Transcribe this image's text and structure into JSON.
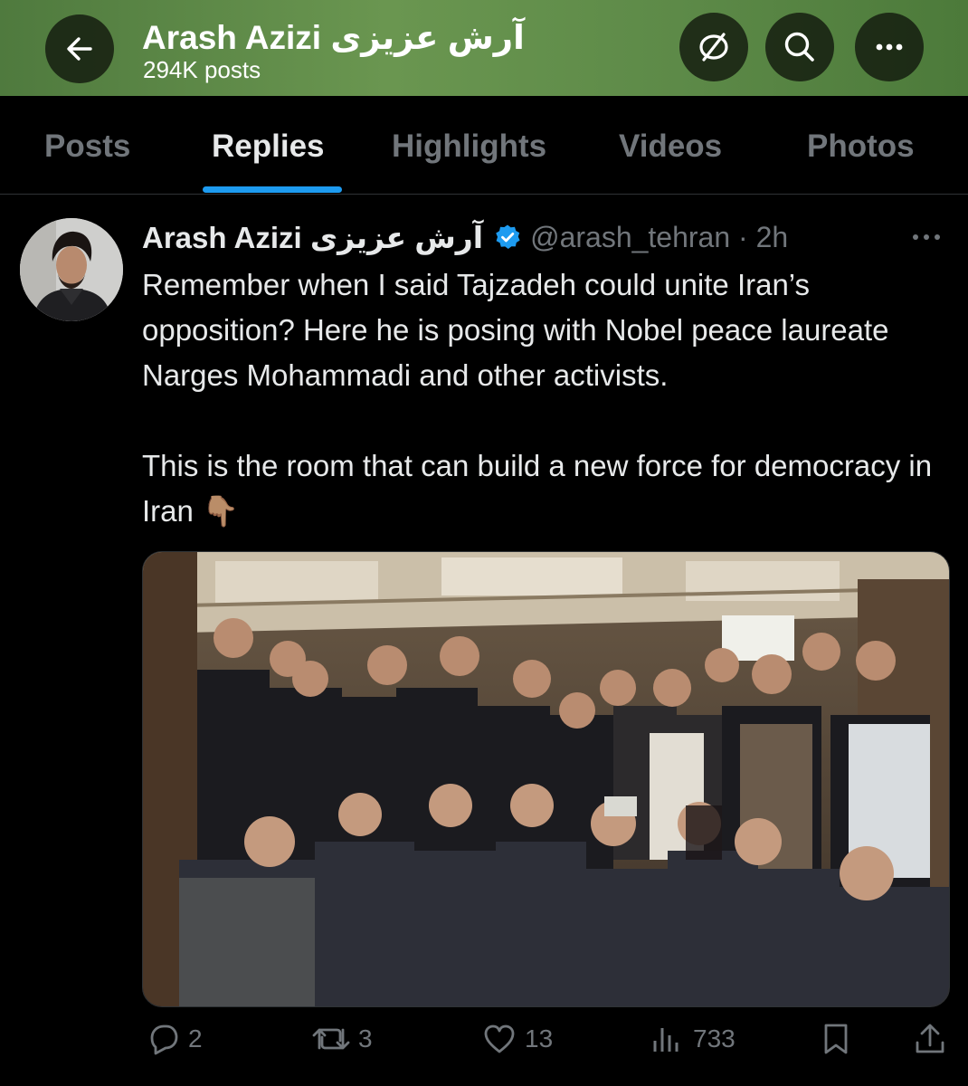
{
  "header": {
    "title": "Arash Azizi آرش عزیزی",
    "post_count": "294K posts",
    "icons": [
      "back-arrow-icon",
      "hide-icon",
      "search-icon",
      "more-icon"
    ],
    "accent_color": "#5f8c49"
  },
  "tabs": [
    {
      "label": "Posts",
      "active": false
    },
    {
      "label": "Replies",
      "active": true
    },
    {
      "label": "Highlights",
      "active": false
    },
    {
      "label": "Videos",
      "active": false
    },
    {
      "label": "Photos",
      "active": false
    }
  ],
  "tweet": {
    "author_name": "Arash Azizi آرش عزیزی",
    "verified": true,
    "handle_time": "@arash_tehran · 2h",
    "text_1": "Remember when I said Tajzadeh could unite Iran’s opposition? Here he is posing with Nobel peace laureate Narges Mohammadi and other activists.",
    "text_2": "This is the room that can build a new force for democracy in Iran 👇🏽",
    "actions": {
      "replies": "2",
      "reposts": "3",
      "likes": "13",
      "views": "733"
    }
  },
  "colors": {
    "background": "#000000",
    "text": "#e7e9ea",
    "muted": "#71767b",
    "accent_blue": "#1d9bf0"
  }
}
